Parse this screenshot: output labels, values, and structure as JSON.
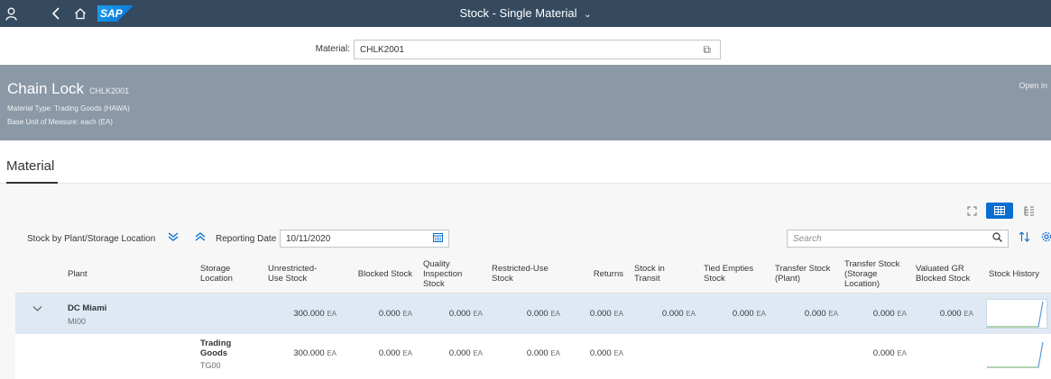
{
  "shell": {
    "title": "Stock - Single Material",
    "logo": "SAP",
    "icons": [
      "user-icon",
      "back-icon",
      "home-icon",
      "chevron-down-icon"
    ]
  },
  "material_filter": {
    "label": "Material:",
    "value": "CHLK2001"
  },
  "header": {
    "title": "Chain Lock",
    "subtitle": "CHLK2001",
    "material_type": "Material Type: Trading Goods (HAWA)",
    "base_unit": "Base Unit of Measure: each (EA)",
    "open_in": "Open in"
  },
  "section": {
    "tab": "Material"
  },
  "toolbar": {
    "group_label": "Stock by Plant/Storage Location",
    "reporting_date_label": "Reporting Date",
    "reporting_date": "10/11/2020",
    "search_placeholder": "Search"
  },
  "columns": {
    "plant": "Plant",
    "storage_location": "Storage Location",
    "unrestricted": "Unrestricted-Use Stock",
    "blocked": "Blocked Stock",
    "quality": "Quality Inspection Stock",
    "restricted": "Restricted-Use Stock",
    "returns": "Returns",
    "in_transit": "Stock in Transit",
    "tied_empties": "Tied Empties Stock",
    "transfer_plant": "Transfer Stock (Plant)",
    "transfer_sloc": "Transfer Stock (Storage Location)",
    "valuated_gr": "Valuated GR Blocked Stock",
    "history": "Stock History"
  },
  "rows": [
    {
      "plant_name": "DC Miami",
      "plant_code": "MI00",
      "unrestricted": "300.000",
      "blocked": "0.000",
      "quality": "0.000",
      "restricted": "0.000",
      "returns": "0.000",
      "in_transit": "0.000",
      "tied_empties": "0.000",
      "transfer_plant": "0.000",
      "transfer_sloc": "0.000",
      "valuated_gr": "0.000",
      "unit": "EA"
    },
    {
      "sloc_name": "Trading Goods",
      "sloc_code": "TG00",
      "unrestricted": "300.000",
      "blocked": "0.000",
      "quality": "0.000",
      "restricted": "0.000",
      "returns": "0.000",
      "transfer_sloc": "0.000",
      "unit": "EA"
    }
  ],
  "colors": {
    "shell": "#354a5f",
    "header": "#8b98a5",
    "accent": "#0a6ed1",
    "group_row": "#dfe9f3"
  }
}
